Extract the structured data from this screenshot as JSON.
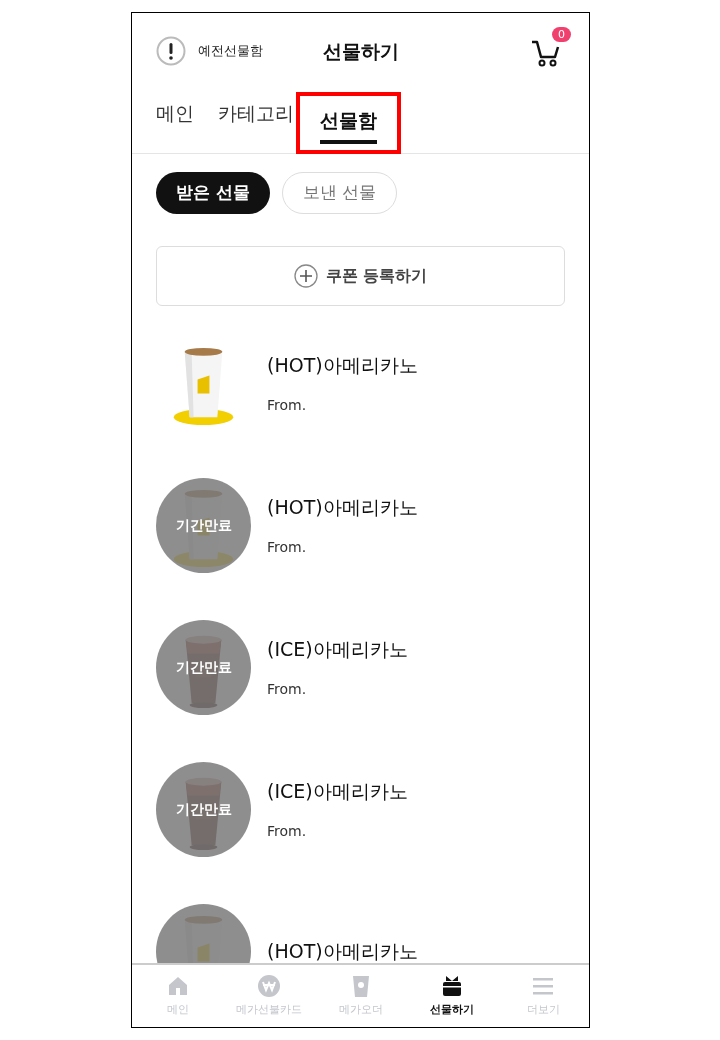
{
  "header": {
    "old_box_label": "예전선물함",
    "title": "선물하기",
    "cart_count": "0"
  },
  "tabs": [
    {
      "label": "메인",
      "selected": false,
      "highlighted": false
    },
    {
      "label": "카테고리",
      "selected": false,
      "highlighted": false
    },
    {
      "label": "선물함",
      "selected": true,
      "highlighted": true
    }
  ],
  "filters": [
    {
      "label": "받은 선물",
      "selected": true
    },
    {
      "label": "보낸 선물",
      "selected": false
    }
  ],
  "coupon_button": "쿠폰 등록하기",
  "gifts": [
    {
      "name": "(HOT)아메리카노",
      "from": "From.",
      "kind": "hot",
      "dimmed": false
    },
    {
      "name": "(HOT)아메리카노",
      "from": "From.",
      "kind": "hot",
      "dimmed": true,
      "status": "기간만료"
    },
    {
      "name": "(ICE)아메리카노",
      "from": "From.",
      "kind": "ice",
      "dimmed": true,
      "status": "기간만료"
    },
    {
      "name": "(ICE)아메리카노",
      "from": "From.",
      "kind": "ice",
      "dimmed": true,
      "status": "기간만료"
    },
    {
      "name": "(HOT)아메리카노",
      "kind": "hot",
      "dimmed": true
    }
  ],
  "bottom_nav": [
    {
      "label": "메인",
      "kind": "home",
      "selected": false
    },
    {
      "label": "메가선불카드",
      "kind": "card",
      "selected": false
    },
    {
      "label": "메가오더",
      "kind": "order",
      "selected": false
    },
    {
      "label": "선물하기",
      "kind": "gift",
      "selected": true
    },
    {
      "label": "더보기",
      "kind": "more",
      "selected": false
    }
  ]
}
